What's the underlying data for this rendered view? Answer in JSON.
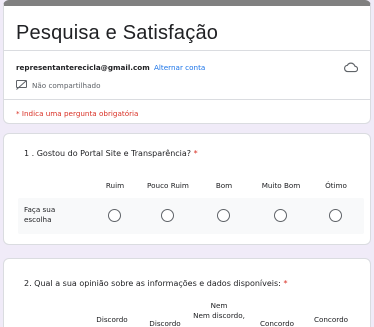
{
  "form": {
    "title": "Pesquisa e Satisfação",
    "account_email": "representanterecicla@gmail.com",
    "switch_account": "Alternar conta",
    "not_shared": "Não compartilhado",
    "required_note": "* Indica uma pergunta obrigatória"
  },
  "icons": {
    "cloud": "cloud-save-icon",
    "share": "not-shared-icon"
  },
  "q1": {
    "title": "1 . Gostou do Portal Site e Transparência?",
    "required_mark": "*",
    "columns": [
      "Ruim",
      "Pouco Ruim",
      "Bom",
      "Muito Bom",
      "Ótimo"
    ],
    "row_label": "Faça sua escolha"
  },
  "q2": {
    "title": "2. Qual a sua opinião sobre as informações e dados disponíveis:",
    "required_mark": "*",
    "columns": [
      "Discordo",
      "Discordo",
      "Nem discordo,",
      "Concordo",
      "Concordo"
    ]
  },
  "colors": {
    "background": "#f0ebf8",
    "header_bar": "#808080",
    "link": "#1a73e8",
    "required": "#d93025"
  }
}
